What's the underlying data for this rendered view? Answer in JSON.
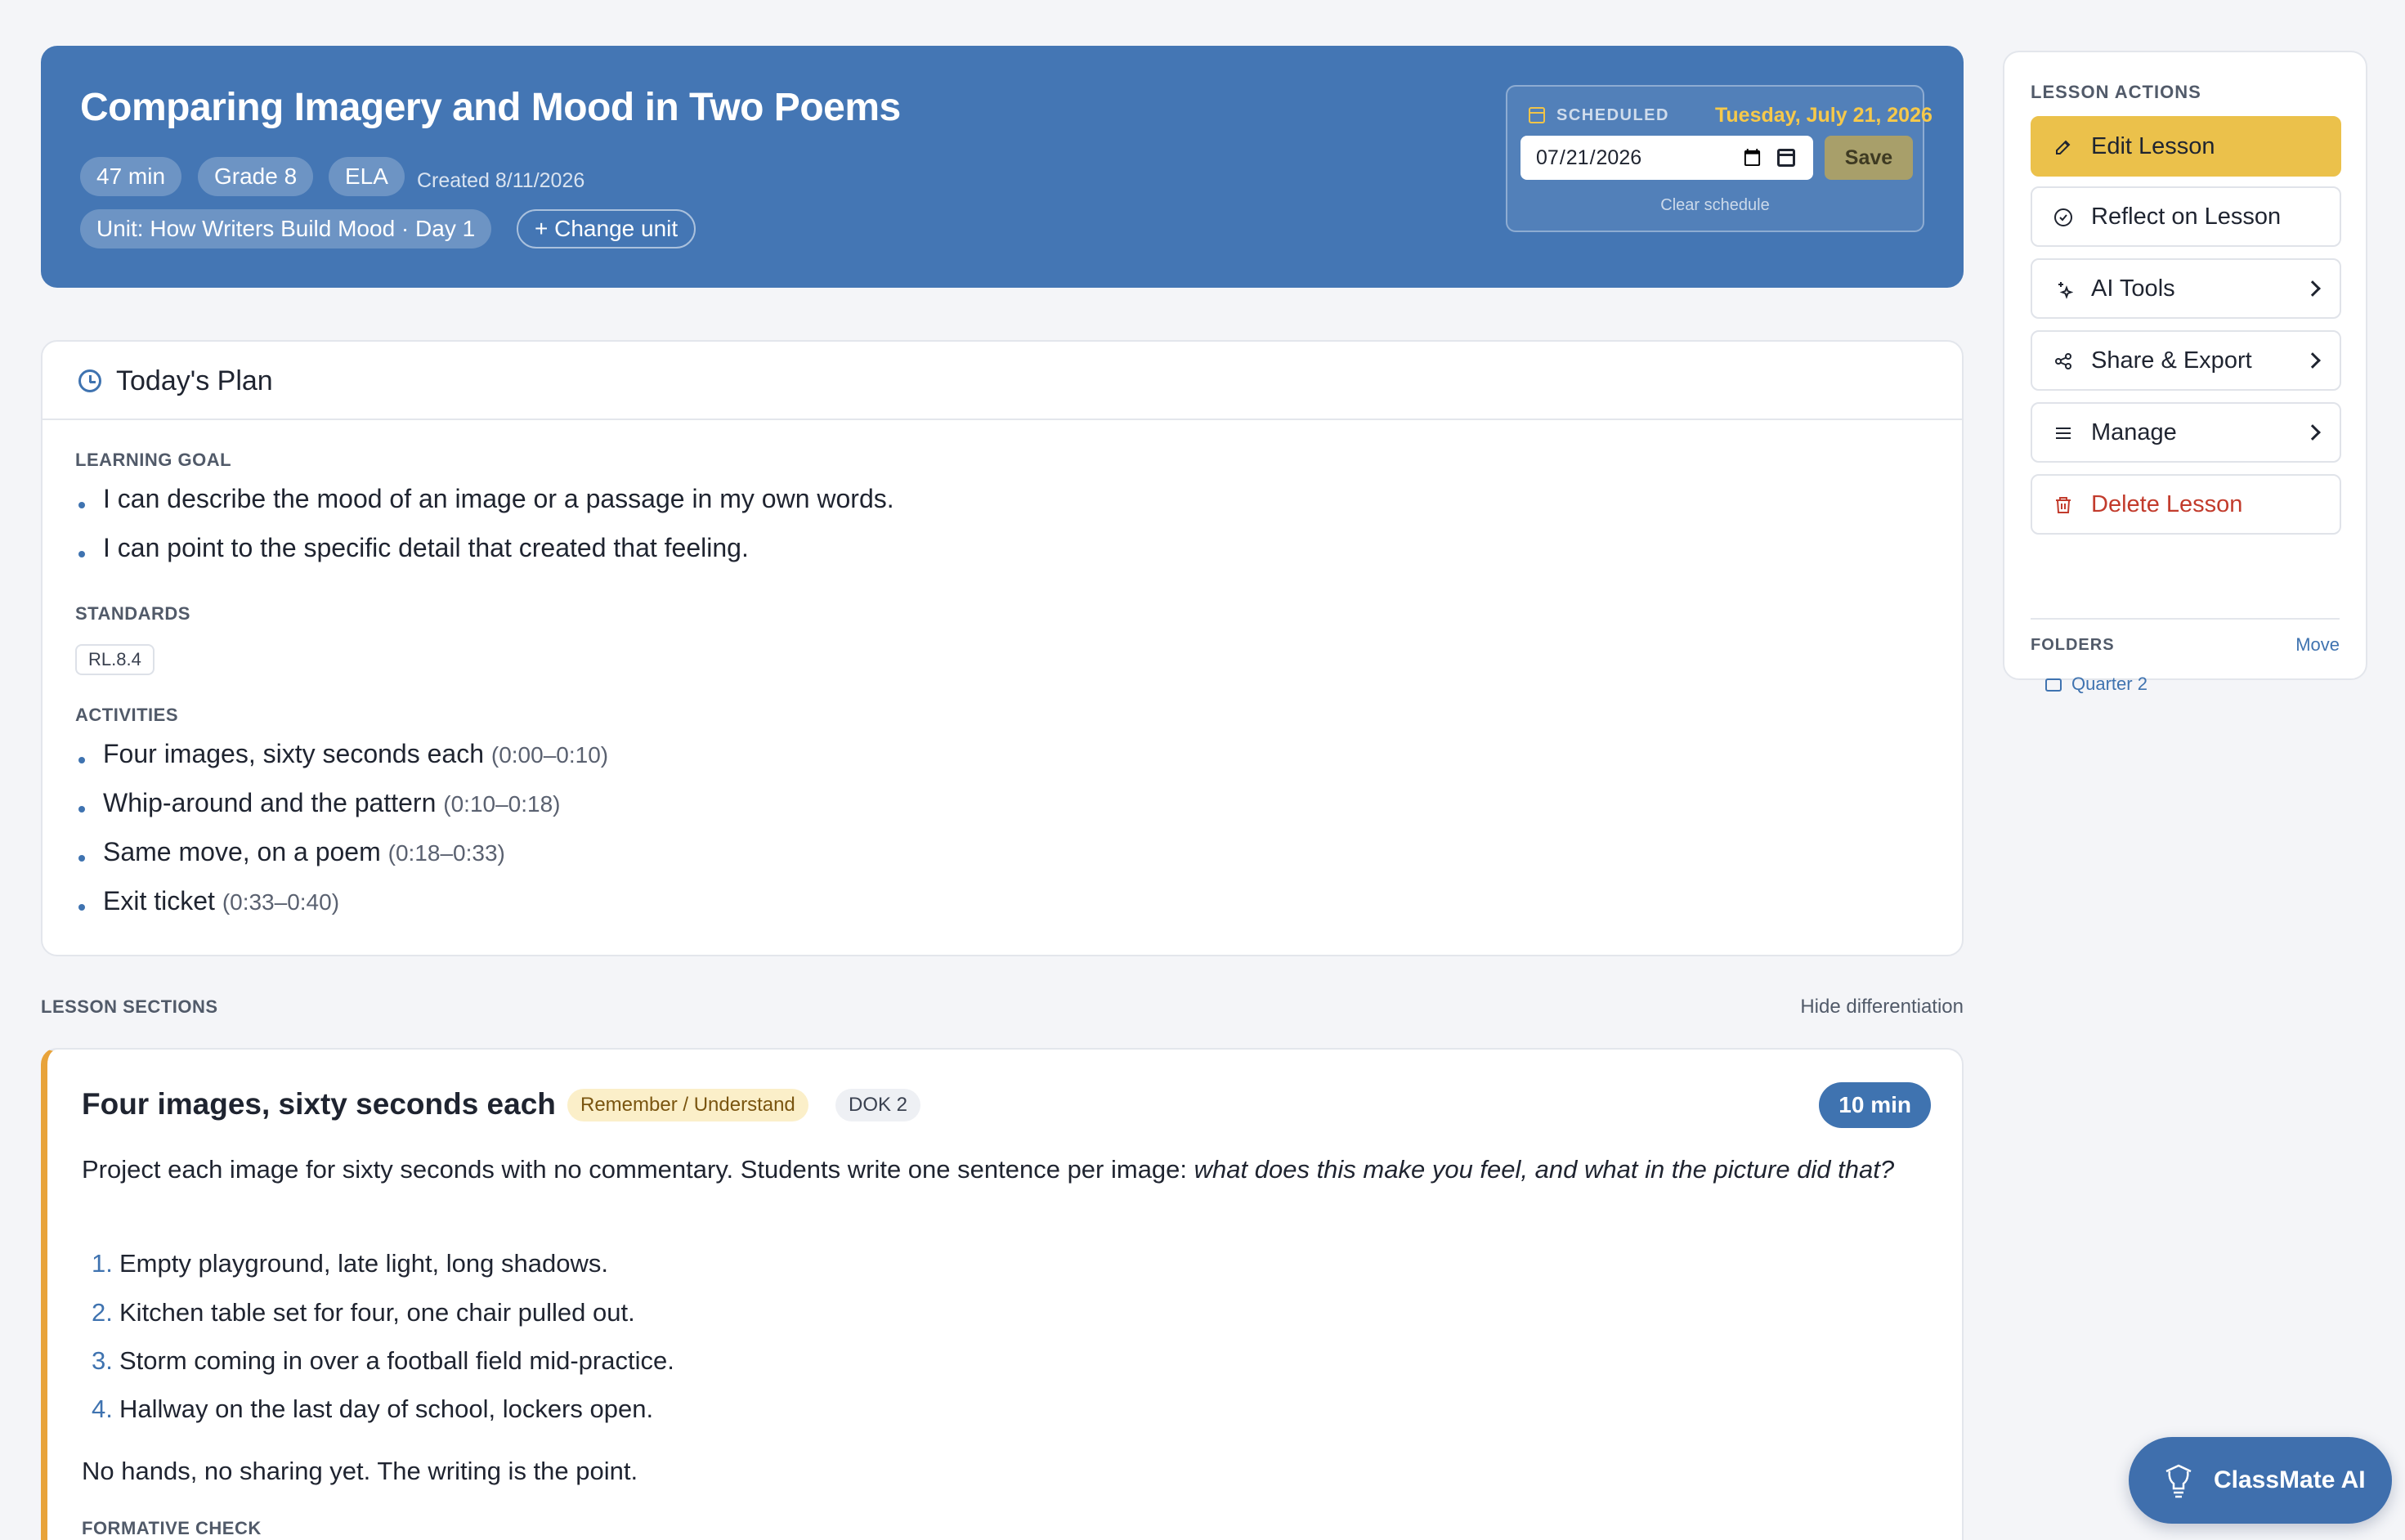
{
  "header": {
    "title": "Comparing Imagery and Mood in Two Poems",
    "chips": [
      "47 min",
      "Grade 8",
      "ELA"
    ],
    "created": "Created 8/11/2026",
    "unit_chip": "Unit: How Writers Build Mood · Day 1",
    "change_unit": "+ Change unit",
    "schedule": {
      "label": "SCHEDULED",
      "date_text": "Tuesday, July 21, 2026",
      "input_value": "2026-07-21",
      "save_label": "Save",
      "clear_label": "Clear schedule"
    }
  },
  "plan": {
    "title": "Today's Plan",
    "learning_goal_label": "LEARNING GOAL",
    "learning_goals": [
      "I can describe the mood of an image or a passage in my own words.",
      "I can point to the specific detail that created that feeling."
    ],
    "standards_label": "STANDARDS",
    "standards": [
      "RL.8.4"
    ],
    "activities_label": "ACTIVITIES",
    "activities": [
      {
        "name": "Four images, sixty seconds each",
        "time": "(0:00–0:10)"
      },
      {
        "name": "Whip-around and the pattern",
        "time": "(0:10–0:18)"
      },
      {
        "name": "Same move, on a poem",
        "time": "(0:18–0:33)"
      },
      {
        "name": "Exit ticket",
        "time": "(0:33–0:40)"
      }
    ]
  },
  "sections_header": {
    "label": "LESSON SECTIONS",
    "toggle": "Hide differentiation"
  },
  "section1": {
    "title": "Four images, sixty seconds each",
    "bloom": "Remember / Understand",
    "dok": "DOK 2",
    "minutes": "10 min",
    "desc_plain": "Project each image for sixty seconds with no commentary. Students write one sentence per image: ",
    "desc_italic": "what does this make you feel, and what in the picture did that?",
    "items": [
      {
        "n": "1.",
        "text": "Empty playground, late light, long shadows."
      },
      {
        "n": "2.",
        "text": "Kitchen table set for four, one chair pulled out."
      },
      {
        "n": "3.",
        "text": "Storm coming in over a football field mid-practice."
      },
      {
        "n": "4.",
        "text": "Hallway on the last day of school, lockers open."
      }
    ],
    "note": "No hands, no sharing yet. The writing is the point.",
    "formative_label": "FORMATIVE CHECK"
  },
  "panel": {
    "label": "LESSON ACTIONS",
    "actions": [
      {
        "label": "Edit Lesson",
        "icon": "edit-icon"
      },
      {
        "label": "Reflect on Lesson",
        "icon": "check-circle-icon"
      },
      {
        "label": "AI Tools",
        "icon": "sparkles-icon"
      },
      {
        "label": "Share & Export",
        "icon": "share-icon"
      },
      {
        "label": "Manage",
        "icon": "menu-icon"
      },
      {
        "label": "Delete Lesson",
        "icon": "trash-icon"
      }
    ],
    "folders_label": "FOLDERS",
    "move_label": "Move",
    "folder": "Quarter 2"
  },
  "fab": {
    "label": "ClassMate AI",
    "icon": "lightbulb-icon"
  },
  "colors": {
    "header_bg": "#4476b4",
    "accent_blue": "#3f73b0",
    "primary_yellow": "#ebc14b",
    "section_accent": "#e8a33a",
    "danger": "#c23b2c"
  }
}
